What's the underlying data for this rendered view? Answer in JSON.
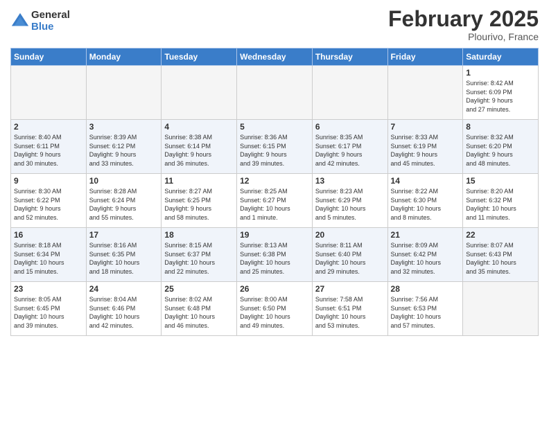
{
  "logo": {
    "general": "General",
    "blue": "Blue"
  },
  "title": "February 2025",
  "location": "Plourivo, France",
  "days_of_week": [
    "Sunday",
    "Monday",
    "Tuesday",
    "Wednesday",
    "Thursday",
    "Friday",
    "Saturday"
  ],
  "weeks": [
    [
      {
        "num": "",
        "info": "",
        "empty": true
      },
      {
        "num": "",
        "info": "",
        "empty": true
      },
      {
        "num": "",
        "info": "",
        "empty": true
      },
      {
        "num": "",
        "info": "",
        "empty": true
      },
      {
        "num": "",
        "info": "",
        "empty": true
      },
      {
        "num": "",
        "info": "",
        "empty": true
      },
      {
        "num": "1",
        "info": "Sunrise: 8:42 AM\nSunset: 6:09 PM\nDaylight: 9 hours\nand 27 minutes.",
        "empty": false
      }
    ],
    [
      {
        "num": "2",
        "info": "Sunrise: 8:40 AM\nSunset: 6:11 PM\nDaylight: 9 hours\nand 30 minutes.",
        "empty": false
      },
      {
        "num": "3",
        "info": "Sunrise: 8:39 AM\nSunset: 6:12 PM\nDaylight: 9 hours\nand 33 minutes.",
        "empty": false
      },
      {
        "num": "4",
        "info": "Sunrise: 8:38 AM\nSunset: 6:14 PM\nDaylight: 9 hours\nand 36 minutes.",
        "empty": false
      },
      {
        "num": "5",
        "info": "Sunrise: 8:36 AM\nSunset: 6:15 PM\nDaylight: 9 hours\nand 39 minutes.",
        "empty": false
      },
      {
        "num": "6",
        "info": "Sunrise: 8:35 AM\nSunset: 6:17 PM\nDaylight: 9 hours\nand 42 minutes.",
        "empty": false
      },
      {
        "num": "7",
        "info": "Sunrise: 8:33 AM\nSunset: 6:19 PM\nDaylight: 9 hours\nand 45 minutes.",
        "empty": false
      },
      {
        "num": "8",
        "info": "Sunrise: 8:32 AM\nSunset: 6:20 PM\nDaylight: 9 hours\nand 48 minutes.",
        "empty": false
      }
    ],
    [
      {
        "num": "9",
        "info": "Sunrise: 8:30 AM\nSunset: 6:22 PM\nDaylight: 9 hours\nand 52 minutes.",
        "empty": false
      },
      {
        "num": "10",
        "info": "Sunrise: 8:28 AM\nSunset: 6:24 PM\nDaylight: 9 hours\nand 55 minutes.",
        "empty": false
      },
      {
        "num": "11",
        "info": "Sunrise: 8:27 AM\nSunset: 6:25 PM\nDaylight: 9 hours\nand 58 minutes.",
        "empty": false
      },
      {
        "num": "12",
        "info": "Sunrise: 8:25 AM\nSunset: 6:27 PM\nDaylight: 10 hours\nand 1 minute.",
        "empty": false
      },
      {
        "num": "13",
        "info": "Sunrise: 8:23 AM\nSunset: 6:29 PM\nDaylight: 10 hours\nand 5 minutes.",
        "empty": false
      },
      {
        "num": "14",
        "info": "Sunrise: 8:22 AM\nSunset: 6:30 PM\nDaylight: 10 hours\nand 8 minutes.",
        "empty": false
      },
      {
        "num": "15",
        "info": "Sunrise: 8:20 AM\nSunset: 6:32 PM\nDaylight: 10 hours\nand 11 minutes.",
        "empty": false
      }
    ],
    [
      {
        "num": "16",
        "info": "Sunrise: 8:18 AM\nSunset: 6:34 PM\nDaylight: 10 hours\nand 15 minutes.",
        "empty": false
      },
      {
        "num": "17",
        "info": "Sunrise: 8:16 AM\nSunset: 6:35 PM\nDaylight: 10 hours\nand 18 minutes.",
        "empty": false
      },
      {
        "num": "18",
        "info": "Sunrise: 8:15 AM\nSunset: 6:37 PM\nDaylight: 10 hours\nand 22 minutes.",
        "empty": false
      },
      {
        "num": "19",
        "info": "Sunrise: 8:13 AM\nSunset: 6:38 PM\nDaylight: 10 hours\nand 25 minutes.",
        "empty": false
      },
      {
        "num": "20",
        "info": "Sunrise: 8:11 AM\nSunset: 6:40 PM\nDaylight: 10 hours\nand 29 minutes.",
        "empty": false
      },
      {
        "num": "21",
        "info": "Sunrise: 8:09 AM\nSunset: 6:42 PM\nDaylight: 10 hours\nand 32 minutes.",
        "empty": false
      },
      {
        "num": "22",
        "info": "Sunrise: 8:07 AM\nSunset: 6:43 PM\nDaylight: 10 hours\nand 35 minutes.",
        "empty": false
      }
    ],
    [
      {
        "num": "23",
        "info": "Sunrise: 8:05 AM\nSunset: 6:45 PM\nDaylight: 10 hours\nand 39 minutes.",
        "empty": false
      },
      {
        "num": "24",
        "info": "Sunrise: 8:04 AM\nSunset: 6:46 PM\nDaylight: 10 hours\nand 42 minutes.",
        "empty": false
      },
      {
        "num": "25",
        "info": "Sunrise: 8:02 AM\nSunset: 6:48 PM\nDaylight: 10 hours\nand 46 minutes.",
        "empty": false
      },
      {
        "num": "26",
        "info": "Sunrise: 8:00 AM\nSunset: 6:50 PM\nDaylight: 10 hours\nand 49 minutes.",
        "empty": false
      },
      {
        "num": "27",
        "info": "Sunrise: 7:58 AM\nSunset: 6:51 PM\nDaylight: 10 hours\nand 53 minutes.",
        "empty": false
      },
      {
        "num": "28",
        "info": "Sunrise: 7:56 AM\nSunset: 6:53 PM\nDaylight: 10 hours\nand 57 minutes.",
        "empty": false
      },
      {
        "num": "",
        "info": "",
        "empty": true
      }
    ]
  ]
}
